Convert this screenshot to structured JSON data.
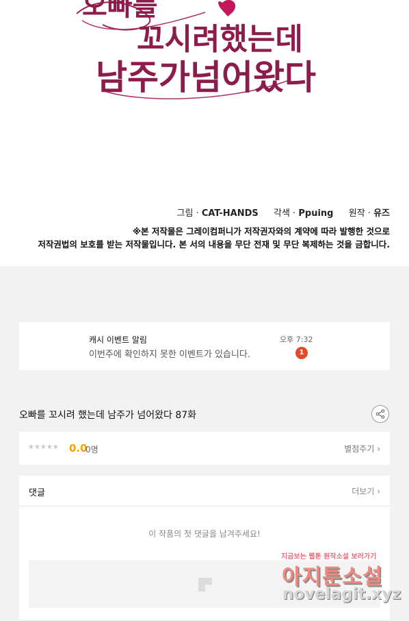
{
  "title_art": {
    "line1": "오빠를",
    "line2": "꼬시려했는데",
    "line3": "남주가넘어왔다"
  },
  "credits": {
    "art_label": "그림 ·",
    "art_name": "CAT-HANDS",
    "adapt_label": "각색 ·",
    "adapt_name": "Ppuing",
    "original_label": "원작 ·",
    "original_name": "유즈"
  },
  "notice": {
    "line1": "※본 저작물은 그레이컴퍼니가 저작권자와의 계약에 따라 발행한 것으로",
    "line2": "저작권법의 보호를 받는 저작물입니다. 본 서의 내용을 무단 전재 및 무단 복제하는 것을 금합니다."
  },
  "notification": {
    "title": "캐시 이벤트 알림",
    "body": "이번주에 확인하지 못한 이벤트가 있습니다.",
    "time": "오후 7:32",
    "badge": "1"
  },
  "episode": {
    "title": "오빠를 꼬시려 했는데 남주가 넘어왔다 87화",
    "share_icon": "share-icon"
  },
  "rating": {
    "stars": "★★★★★",
    "score": "0.0",
    "count": "0명",
    "rate_link": "별점주기",
    "score_value": 0.0
  },
  "comments": {
    "header": "댓글",
    "more_link": "더보기",
    "empty_text": "이 작품의 첫 댓글을 남겨주세요!"
  },
  "watermark": {
    "top": "지금보는 웹툰 원작소설 보러가기",
    "main": "아지툰소설",
    "url": "novelagit.xyz"
  },
  "colors": {
    "title_art": "#8c1c4b",
    "score": "#f0a500",
    "badge": "#e44a2a",
    "page_background": "#f2f2f2"
  }
}
